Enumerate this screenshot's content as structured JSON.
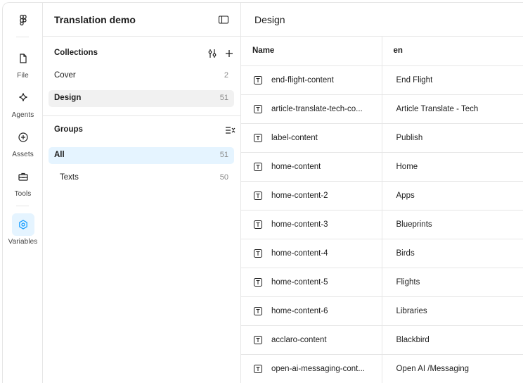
{
  "rail": {
    "items": [
      {
        "label": "File",
        "icon": "file-icon"
      },
      {
        "label": "Agents",
        "icon": "sparkle-icon"
      },
      {
        "label": "Assets",
        "icon": "plus-circle-icon"
      },
      {
        "label": "Tools",
        "icon": "toolbox-icon"
      },
      {
        "label": "Variables",
        "icon": "hexagon-icon",
        "active": true
      }
    ],
    "active_color": "#e5f4ff",
    "accent_color": "#0d99ff"
  },
  "panel": {
    "file_title": "Translation demo",
    "collections_title": "Collections",
    "collections": [
      {
        "label": "Cover",
        "count": "2"
      },
      {
        "label": "Design",
        "count": "51",
        "selected": true
      }
    ],
    "groups_title": "Groups",
    "groups": [
      {
        "label": "All",
        "count": "51",
        "selected": true
      },
      {
        "label": "Texts",
        "count": "50"
      }
    ]
  },
  "main": {
    "title": "Design",
    "columns": [
      "Name",
      "en"
    ],
    "rows": [
      {
        "name": "end-flight-content",
        "value": "End Flight"
      },
      {
        "name": "article-translate-tech-co...",
        "value": "Article Translate - Tech"
      },
      {
        "name": "label-content",
        "value": "Publish"
      },
      {
        "name": "home-content",
        "value": "Home"
      },
      {
        "name": "home-content-2",
        "value": "Apps"
      },
      {
        "name": "home-content-3",
        "value": "Blueprints"
      },
      {
        "name": "home-content-4",
        "value": "Birds"
      },
      {
        "name": "home-content-5",
        "value": "Flights"
      },
      {
        "name": "home-content-6",
        "value": "Libraries"
      },
      {
        "name": "acclaro-content",
        "value": "Blackbird"
      },
      {
        "name": "open-ai-messaging-cont...",
        "value": "Open AI /Messaging"
      }
    ]
  }
}
